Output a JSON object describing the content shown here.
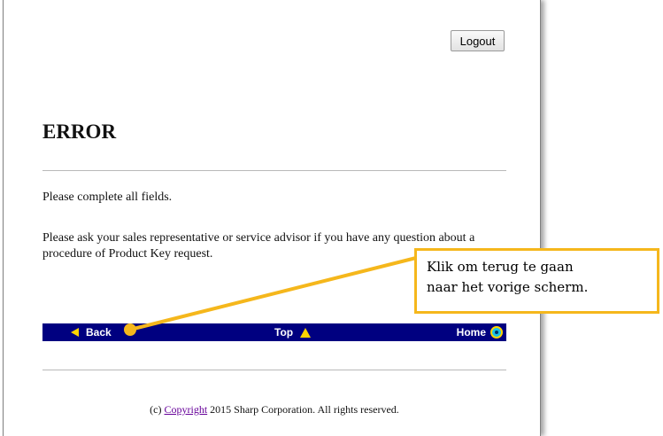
{
  "header": {
    "logout_label": "Logout"
  },
  "main": {
    "title": "ERROR",
    "message1": "Please complete all fields.",
    "message2": "Please ask your sales representative or service advisor if you have any question about a procedure of Product Key request."
  },
  "navbar": {
    "back_label": "Back",
    "top_label": "Top",
    "home_label": "Home"
  },
  "footer": {
    "prefix": "(c) ",
    "copyright_link": "Copyright",
    "suffix": " 2015 Sharp Corporation. All rights reserved."
  },
  "callout": {
    "line1": "Klik om terug te gaan",
    "line2": "naar het vorige scherm."
  },
  "colors": {
    "navbar": "#000080",
    "accent": "#f5b71c",
    "link": "#660099"
  }
}
